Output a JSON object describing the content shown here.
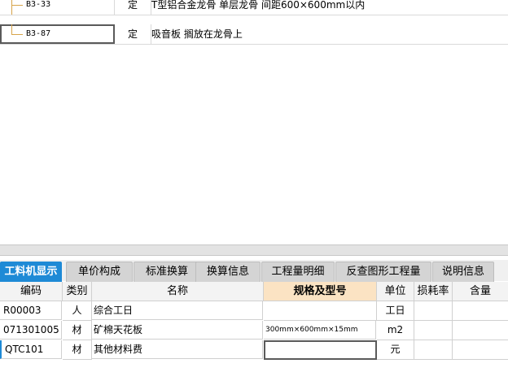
{
  "top_table": {
    "rows": [
      {
        "code": "B3-33",
        "type": "定",
        "name": "T型铝合金龙骨 单层龙骨 间距600×600mm以内"
      },
      {
        "code": "B3-87",
        "type": "定",
        "name": "吸音板 搁放在龙骨上"
      }
    ]
  },
  "tabs": [
    {
      "label": "工料机显示",
      "active": true
    },
    {
      "label": "单价构成"
    },
    {
      "label": "标准换算"
    },
    {
      "label": "换算信息"
    },
    {
      "label": "工程量明细"
    },
    {
      "label": "反查图形工程量"
    },
    {
      "label": "说明信息"
    }
  ],
  "grid": {
    "headers": [
      "编码",
      "类别",
      "名称",
      "规格及型号",
      "单位",
      "损耗率",
      "含量"
    ],
    "rows": [
      {
        "code": "R00003",
        "category": "人",
        "name": "综合工日",
        "spec": "",
        "unit": "工日",
        "loss": "",
        "qty": ""
      },
      {
        "code": "071301005",
        "category": "材",
        "name": "矿棉天花板",
        "spec": "300mm×600mm×15mm",
        "unit": "m2",
        "loss": "",
        "qty": ""
      },
      {
        "code": "QTC101",
        "category": "材",
        "name": "其他材料费",
        "spec": "",
        "unit": "元",
        "loss": "",
        "qty": ""
      }
    ]
  },
  "colors": {
    "active_tab": "#1e8ad6",
    "spec_header": "#fbe3c3",
    "tree_line": "#d7a44a"
  }
}
